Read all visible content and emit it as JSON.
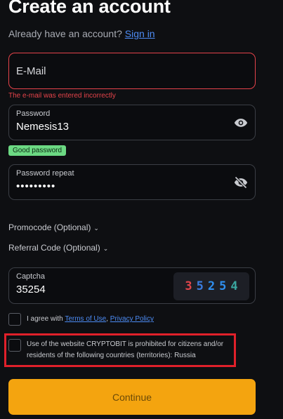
{
  "header": {
    "title": "Create an account",
    "signin_prompt": "Already have an account?",
    "signin_link": "Sign in"
  },
  "email": {
    "placeholder": "E-Mail",
    "error": "The e-mail was entered incorrectly"
  },
  "password": {
    "label": "Password",
    "value": "Nemesis13",
    "strength_badge": "Good password"
  },
  "password_repeat": {
    "label": "Password repeat",
    "value": "•••••••••"
  },
  "promocode": {
    "label": "Promocode (Optional)"
  },
  "referral": {
    "label": "Referral Code (Optional)"
  },
  "captcha": {
    "label": "Captcha",
    "value": "35254",
    "image_digits": [
      {
        "d": "3",
        "color": "#e0454b"
      },
      {
        "d": "5",
        "color": "#3b7de0"
      },
      {
        "d": "2",
        "color": "#2f8ff0"
      },
      {
        "d": "5",
        "color": "#2f8ff0"
      },
      {
        "d": "4",
        "color": "#3aa7a0"
      }
    ]
  },
  "terms": {
    "prefix": "I agree with",
    "terms_link": "Terms of Use",
    "separator": ",",
    "privacy_link": "Privacy Policy"
  },
  "restriction": {
    "text": "Use of the website CRYPTOBIT is prohibited for citizens and/or residents of the following countries (territories): Russia"
  },
  "continue_label": "Continue",
  "colors": {
    "accent": "#f4a40f",
    "error": "#e5434a",
    "link": "#4d8cf5",
    "success": "#6cd983"
  }
}
